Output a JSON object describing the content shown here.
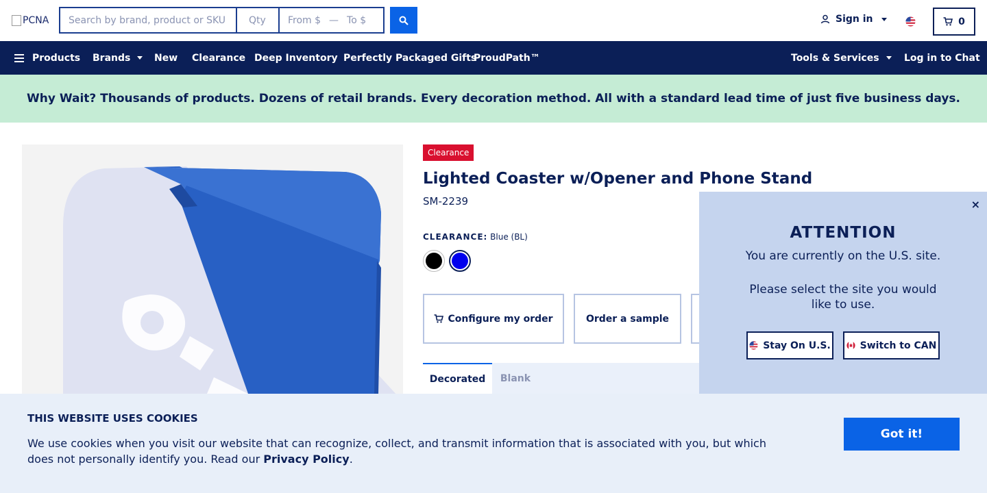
{
  "header": {
    "logo_alt": "PCNA",
    "search_placeholder": "Search by brand, product or SKU",
    "qty_placeholder": "Qty",
    "price_from_placeholder": "From $",
    "price_to_placeholder": "To $",
    "price_separator": "—",
    "sign_in_label": "Sign in",
    "cart_count": "0"
  },
  "nav": {
    "products": "Products",
    "brands": "Brands",
    "new": "New",
    "clearance": "Clearance",
    "deep_inventory": "Deep Inventory",
    "gifts": "Perfectly Packaged Gifts",
    "proudpath": "ProudPath™",
    "tools_services": "Tools & Services",
    "chat": "Log in to Chat"
  },
  "promo": {
    "text": "Why Wait? Thousands of products. Dozens of retail brands. Every decoration method. All with a standard lead time of just five business days."
  },
  "product": {
    "badge": "Clearance",
    "title": "Lighted Coaster w/Opener and Phone Stand",
    "sku": "SM-2239",
    "color_label": "CLEARANCE:",
    "color_value": "Blue (BL)",
    "swatches": [
      {
        "name": "Black",
        "color": "#000000",
        "selected": false
      },
      {
        "name": "Blue",
        "color": "#0000ee",
        "selected": true
      }
    ],
    "configure_label": "Configure my order",
    "sample_label": "Order a sample",
    "tabs": [
      "Decorated",
      "Blank"
    ]
  },
  "attention": {
    "close": "×",
    "title": "ATTENTION",
    "line1": "You are currently on the U.S. site.",
    "line2": "Please select the site you would like to use.",
    "stay_label": "Stay On U.S.",
    "switch_label": "Switch to CAN"
  },
  "cookies": {
    "title": "THIS WEBSITE USES COOKIES",
    "text_before": "We use cookies when you visit our website that can recognize, collect, and transmit information that is associated with you, but which does not personally identify you. Read our",
    "link": "Privacy Policy",
    "text_after": ".",
    "button": "Got it!"
  },
  "colors": {
    "navy": "#0b1f57",
    "accent_blue": "#0a63e6",
    "promo_green": "#c5ecd5",
    "clearance_red": "#d9102f"
  }
}
